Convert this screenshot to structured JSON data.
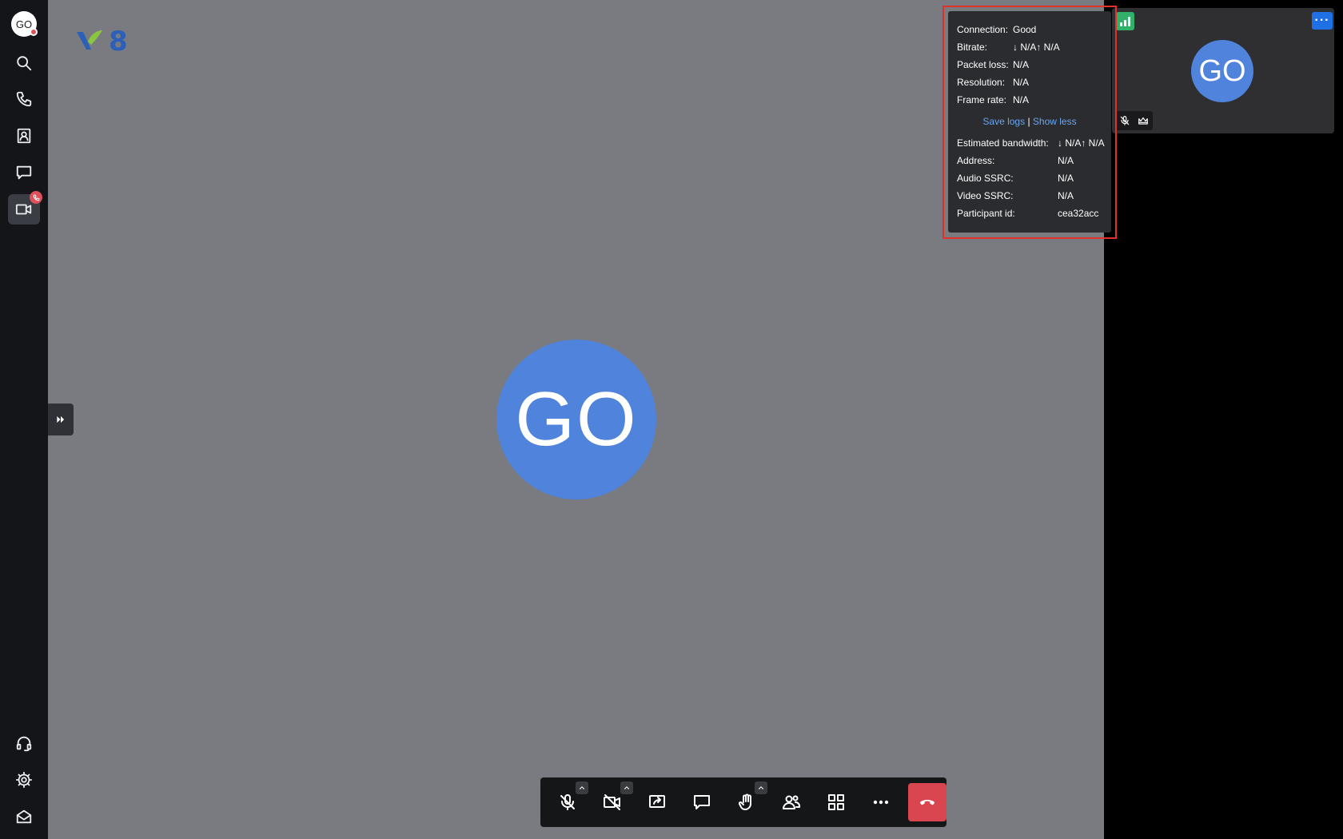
{
  "sidebar": {
    "avatar_initials": "GO",
    "items": [
      {
        "name": "search",
        "icon": "search-icon"
      },
      {
        "name": "calls",
        "icon": "phone-icon"
      },
      {
        "name": "contacts",
        "icon": "contact-card-icon"
      },
      {
        "name": "chat",
        "icon": "chat-bubble-icon"
      },
      {
        "name": "meetings",
        "icon": "video-camera-icon",
        "active": true,
        "badge": "phone-icon"
      }
    ],
    "bottom_items": [
      {
        "name": "support",
        "icon": "headset-icon"
      },
      {
        "name": "settings",
        "icon": "gear-icon"
      },
      {
        "name": "mail",
        "icon": "open-envelope-icon"
      }
    ]
  },
  "stage": {
    "logo_text": "8",
    "participant_initials": "GO",
    "background": "#7a7b80",
    "avatar_color": "#4f83dc"
  },
  "toolbar": {
    "buttons": [
      "microphone-muted",
      "camera-off",
      "share-screen",
      "chat",
      "raise-hand",
      "participants",
      "tile-view",
      "more-options"
    ],
    "hangup_color": "#d9464f"
  },
  "filmstrip": {
    "thumb_initials": "GO",
    "more_label": "···",
    "connection_status_color": "#31b06a"
  },
  "connection_stats": {
    "connection_label": "Connection:",
    "connection_value": "Good",
    "bitrate_label": "Bitrate:",
    "bitrate_value": "↓ N/A↑ N/A",
    "packet_loss_label": "Packet loss:",
    "packet_loss_value": "N/A",
    "resolution_label": "Resolution:",
    "resolution_value": "N/A",
    "frame_rate_label": "Frame rate:",
    "frame_rate_value": "N/A",
    "save_logs_label": "Save logs",
    "separator": "|",
    "show_less_label": "Show less",
    "bandwidth_label": "Estimated bandwidth:",
    "bandwidth_value": "↓ N/A↑ N/A",
    "address_label": "Address:",
    "address_value": "N/A",
    "audio_ssrc_label": "Audio SSRC:",
    "audio_ssrc_value": "N/A",
    "video_ssrc_label": "Video SSRC:",
    "video_ssrc_value": "N/A",
    "participant_id_label": "Participant id:",
    "participant_id_value": "cea32acc"
  }
}
